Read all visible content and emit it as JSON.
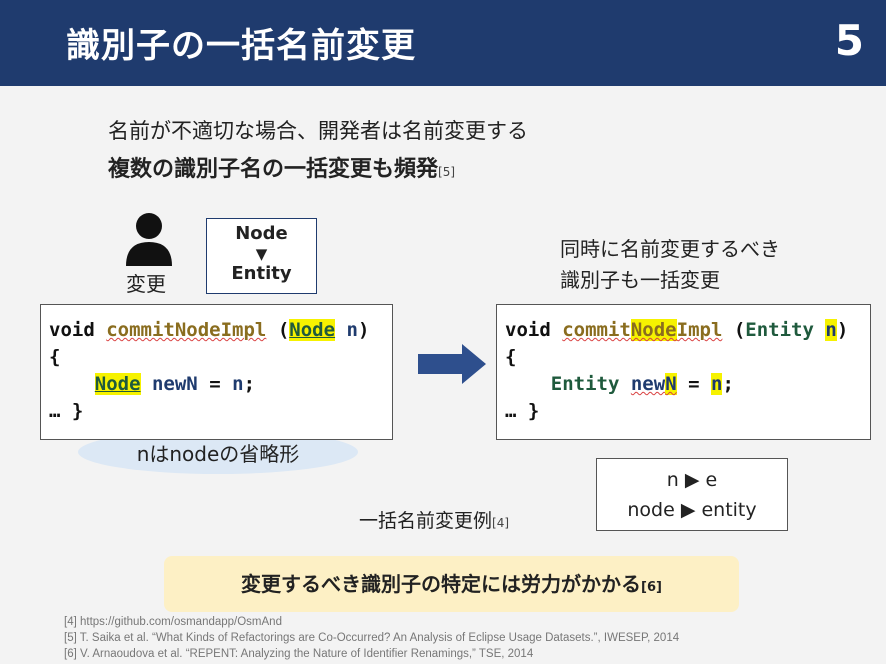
{
  "slide": {
    "title": "識別子の一括名前変更",
    "page_number": "5"
  },
  "intro": {
    "line1": "名前が不適切な場合、開発者は名前変更する",
    "line2": "複数の識別子名の一括変更も頻発",
    "line2_ref": "[5]"
  },
  "person": {
    "label": "変更",
    "icon": "person-icon"
  },
  "rename_box": {
    "from": "Node",
    "arrow": "▼",
    "to": "Entity"
  },
  "right_note": {
    "line1": "同時に名前変更するべき",
    "line2": "識別子も一括変更"
  },
  "code_before": {
    "l1_kw": "void",
    "l1_fn": "commitNodeImpl",
    "l1_open": "(",
    "l1_type": "Node",
    "l1_var": "n",
    "l1_close": ")",
    "l2": "{",
    "l3_type": "Node",
    "l3_var": "newN",
    "l3_eq": "=",
    "l3_val": "n",
    "l3_semi": ";",
    "l4": "… }"
  },
  "code_after": {
    "l1_kw": "void",
    "l1_fn_a": "commit",
    "l1_fn_b": "Node",
    "l1_fn_c": "Impl",
    "l1_open": "(",
    "l1_type": "Entity",
    "l1_var": "n",
    "l1_close": ")",
    "l2": "{",
    "l3_type": "Entity",
    "l3_var_a": "new",
    "l3_var_b": "N",
    "l3_eq": "=",
    "l3_val": "n",
    "l3_semi": ";",
    "l4": "… }"
  },
  "bubble": {
    "label": "nはnodeの省略形"
  },
  "legend": {
    "line1": "n ▶ e",
    "line2": "node ▶ entity"
  },
  "example": {
    "label": "一括名前変更例",
    "ref": "[4]"
  },
  "callout": {
    "text": "変更するべき識別子の特定には労力がかかる",
    "ref": "[6]"
  },
  "footnotes": [
    "[4] https://github.com/osmandapp/OsmAnd",
    "[5] T. Saika et al. “What Kinds of Refactorings are Co-Occurred? An Analysis of Eclipse Usage Datasets.”, IWESEP, 2014",
    "[6] V. Arnaoudova et al. “REPENT: Analyzing the Nature of Identifier Renamings,” TSE, 2014"
  ],
  "colors": {
    "header": "#1f3b6e",
    "highlight": "#f6f200",
    "callout": "#fdf0c5",
    "bubble": "#dce8f5"
  }
}
